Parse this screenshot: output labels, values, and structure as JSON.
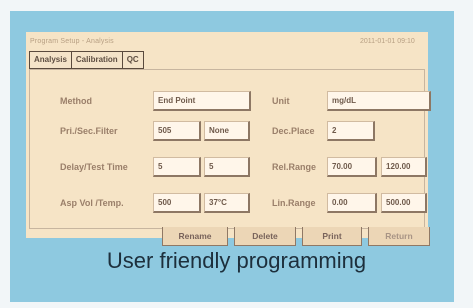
{
  "screen": {
    "title": "Program Setup - Analysis",
    "time": "2011-01-01 09:10"
  },
  "tabs": [
    "Analysis",
    "Calibration",
    "QC"
  ],
  "fields": {
    "method": {
      "label": "Method",
      "value": "End Point"
    },
    "filter": {
      "label": "Pri./Sec.Filter",
      "value1": "505",
      "value2": "None"
    },
    "delay": {
      "label": "Delay/Test Time",
      "value1": "5",
      "value2": "5"
    },
    "asp": {
      "label": "Asp Vol /Temp.",
      "value1": "500",
      "value2": "37°C"
    },
    "unit": {
      "label": "Unit",
      "value": "mg/dL"
    },
    "dec": {
      "label": "Dec.Place",
      "value": "2"
    },
    "rel": {
      "label": "Rel.Range",
      "value1": "70.00",
      "value2": "120.00"
    },
    "lin": {
      "label": "Lin.Range",
      "value1": "0.00",
      "value2": "500.00"
    }
  },
  "buttons": {
    "rename": "Rename",
    "delete": "Delete",
    "print": "Print",
    "return": "Return"
  },
  "caption": "User friendly programming"
}
